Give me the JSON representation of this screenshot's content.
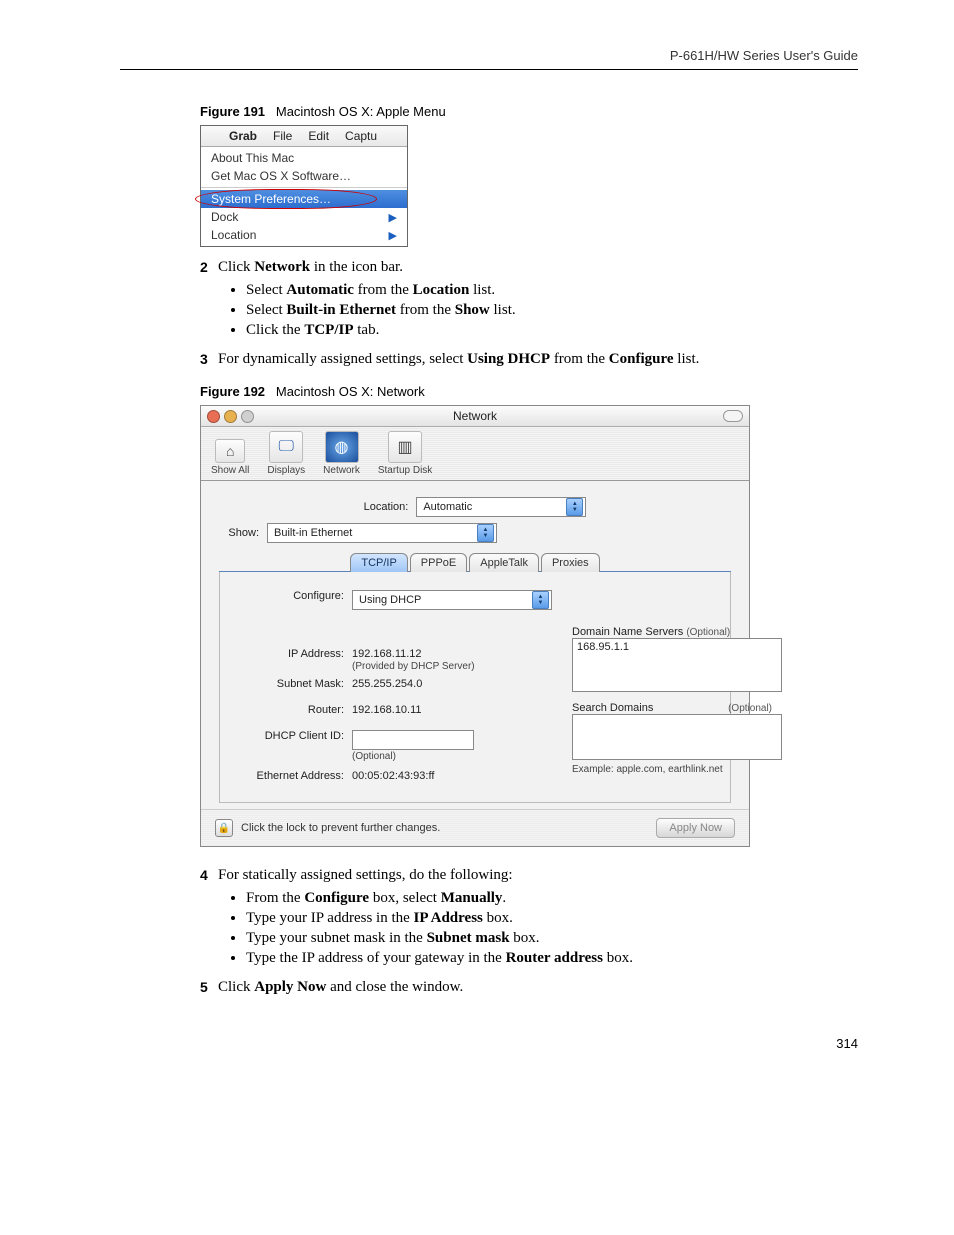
{
  "header": {
    "guide_title": "P-661H/HW Series User's Guide"
  },
  "page_number": "314",
  "fig191": {
    "caption_label": "Figure 191",
    "caption_text": "Macintosh OS X: Apple Menu",
    "menubar": {
      "app": "Grab",
      "items": [
        "File",
        "Edit",
        "Captu"
      ]
    },
    "menu": {
      "about": "About This Mac",
      "software": "Get Mac OS X Software…",
      "sysprefs": "System Preferences…",
      "dock": "Dock",
      "location": "Location"
    }
  },
  "step2": {
    "num": "2",
    "text_pre": "Click ",
    "text_bold": "Network",
    "text_post": " in the icon bar.",
    "b1_pre": "Select ",
    "b1_b1": "Automatic",
    "b1_mid": " from the ",
    "b1_b2": "Location",
    "b1_post": " list.",
    "b2_pre": "Select ",
    "b2_b1": "Built-in Ethernet",
    "b2_mid": " from the ",
    "b2_b2": "Show",
    "b2_post": " list.",
    "b3_pre": "Click the ",
    "b3_b1": "TCP/IP",
    "b3_post": " tab."
  },
  "step3": {
    "num": "3",
    "pre": "For dynamically assigned settings, select ",
    "b1": "Using DHCP",
    "mid": " from the ",
    "b2": "Configure",
    "post": " list."
  },
  "fig192": {
    "caption_label": "Figure 192",
    "caption_text": "Macintosh OS X: Network",
    "title": "Network",
    "toolbar": {
      "showall": "Show All",
      "displays": "Displays",
      "network": "Network",
      "startup": "Startup Disk"
    },
    "location_label": "Location:",
    "location_value": "Automatic",
    "show_label": "Show:",
    "show_value": "Built-in Ethernet",
    "tabs": {
      "tcpip": "TCP/IP",
      "pppoe": "PPPoE",
      "appletalk": "AppleTalk",
      "proxies": "Proxies"
    },
    "configure_label": "Configure:",
    "configure_value": "Using DHCP",
    "ip_label": "IP Address:",
    "ip_value": "192.168.11.12",
    "ip_note": "(Provided by DHCP Server)",
    "subnet_label": "Subnet Mask:",
    "subnet_value": "255.255.254.0",
    "router_label": "Router:",
    "router_value": "192.168.10.11",
    "dhcp_label": "DHCP Client ID:",
    "dhcp_note": "(Optional)",
    "eth_label": "Ethernet Address:",
    "eth_value": "00:05:02:43:93:ff",
    "dns_label": "Domain Name Servers",
    "dns_opt": "(Optional)",
    "dns_value": "168.95.1.1",
    "search_label": "Search Domains",
    "search_opt": "(Optional)",
    "example": "Example: apple.com, earthlink.net",
    "lock_text": "Click the lock to prevent further changes.",
    "apply": "Apply Now"
  },
  "step4": {
    "num": "4",
    "text": "For statically assigned settings, do the following:",
    "b1_pre": "From the ",
    "b1_b1": "Configure",
    "b1_mid": " box, select ",
    "b1_b2": "Manually",
    "b1_post": ".",
    "b2_pre": "Type your IP address in the ",
    "b2_b1": "IP Address",
    "b2_post": " box.",
    "b3_pre": "Type your subnet mask in the ",
    "b3_b1": "Subnet mask",
    "b3_post": " box.",
    "b4_pre": "Type the IP address of your gateway in the ",
    "b4_b1": "Router address",
    "b4_post": " box."
  },
  "step5": {
    "num": "5",
    "pre": "Click ",
    "b1": "Apply Now",
    "post": " and close the window."
  }
}
